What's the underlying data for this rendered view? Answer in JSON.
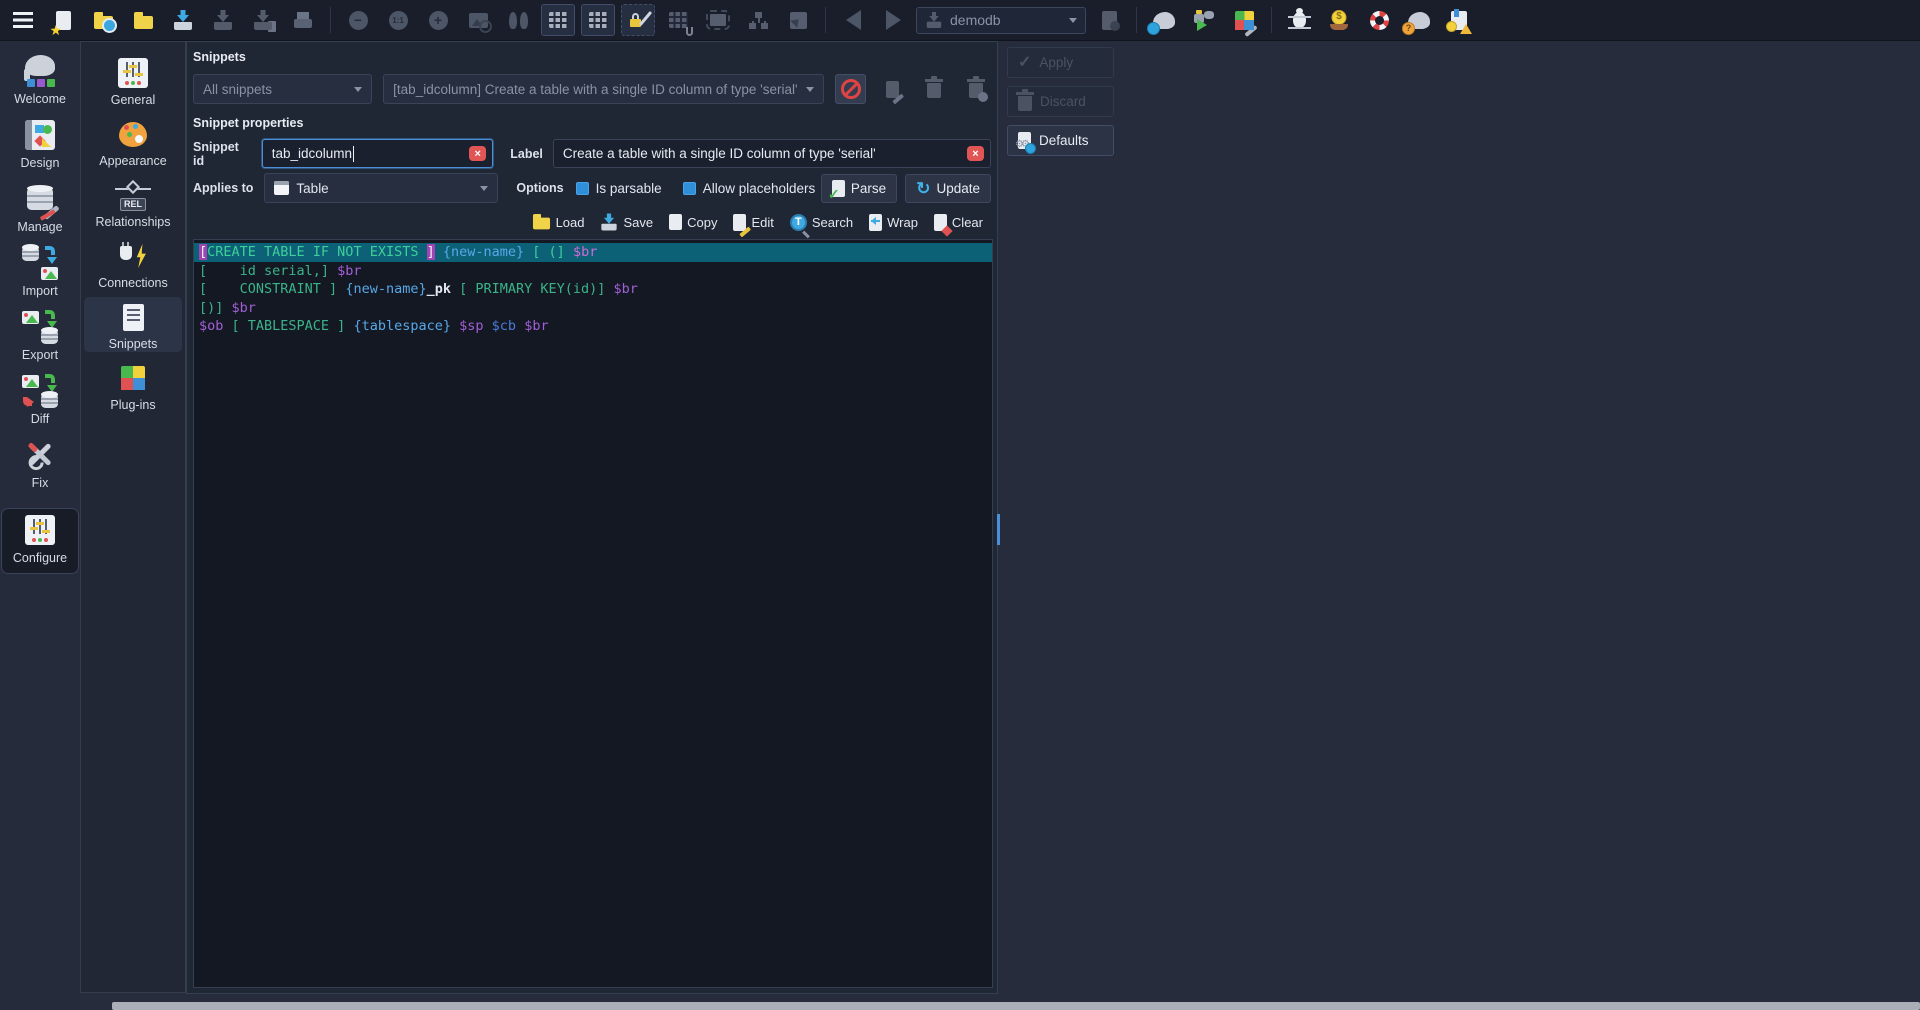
{
  "toolbar": {
    "model_selector_value": "demodb",
    "zoom_level_label": "1:1"
  },
  "activity_bar": {
    "items": [
      {
        "label": "Welcome"
      },
      {
        "label": "Design"
      },
      {
        "label": "Manage"
      },
      {
        "label": "Import"
      },
      {
        "label": "Export"
      },
      {
        "label": "Diff"
      },
      {
        "label": "Fix"
      },
      {
        "label": "Configure"
      }
    ]
  },
  "settings_nav": {
    "rel_badge": "REL",
    "items": [
      {
        "label": "General"
      },
      {
        "label": "Appearance"
      },
      {
        "label": "Relationships"
      },
      {
        "label": "Connections"
      },
      {
        "label": "Snippets"
      },
      {
        "label": "Plug-ins"
      }
    ]
  },
  "snippets_panel": {
    "title": "Snippets",
    "filter_dropdown_value": "All snippets",
    "snippet_dropdown_value": "[tab_idcolumn] Create a table with a single ID column of type 'serial'",
    "properties_title": "Snippet properties",
    "snippet_id_label": "Snippet id",
    "snippet_id_value": "tab_idcolumn",
    "label_label": "Label",
    "label_value": "Create a table with a single ID column of type 'serial'",
    "applies_to_label": "Applies to",
    "applies_to_value": "Table",
    "options_label": "Options",
    "is_parsable_label": "Is parsable",
    "allow_placeholders_label": "Allow placeholders",
    "parse_button_label": "Parse",
    "update_button_label": "Update",
    "editor_toolbar": {
      "load": "Load",
      "save": "Save",
      "copy": "Copy",
      "edit": "Edit",
      "search": "Search",
      "wrap": "Wrap",
      "clear": "Clear"
    },
    "editor_lines": [
      {
        "selected": true,
        "tokens": [
          {
            "t": "[",
            "c": "bm"
          },
          {
            "t": "CREATE TABLE IF NOT EXISTS ",
            "c": "k"
          },
          {
            "t": "]",
            "c": "bm"
          },
          {
            "t": " ",
            "c": "w"
          },
          {
            "t": "{new-name}",
            "c": "p"
          },
          {
            "t": " [ (] ",
            "c": "k"
          },
          {
            "t": "$br",
            "c": "v"
          }
        ]
      },
      {
        "selected": false,
        "tokens": [
          {
            "t": "[    id serial,] ",
            "c": "k"
          },
          {
            "t": "$br",
            "c": "v"
          }
        ]
      },
      {
        "selected": false,
        "tokens": [
          {
            "t": "[    CONSTRAINT ] ",
            "c": "k"
          },
          {
            "t": "{new-name}",
            "c": "p"
          },
          {
            "t": "_pk",
            "c": "w"
          },
          {
            "t": " [ PRIMARY KEY(id)] ",
            "c": "k"
          },
          {
            "t": "$br",
            "c": "v"
          }
        ]
      },
      {
        "selected": false,
        "tokens": [
          {
            "t": "[)] ",
            "c": "k"
          },
          {
            "t": "$br",
            "c": "v"
          }
        ]
      },
      {
        "selected": false,
        "tokens": [
          {
            "t": "$ob",
            "c": "v"
          },
          {
            "t": " [ TABLESPACE ] ",
            "c": "k"
          },
          {
            "t": "{tablespace}",
            "c": "p"
          },
          {
            "t": " ",
            "c": "w"
          },
          {
            "t": "$sp",
            "c": "v"
          },
          {
            "t": " ",
            "c": "w"
          },
          {
            "t": "$cb",
            "c": "c"
          },
          {
            "t": " ",
            "c": "w"
          },
          {
            "t": "$br",
            "c": "v"
          }
        ]
      }
    ]
  },
  "action_buttons": {
    "apply": "Apply",
    "discard": "Discard",
    "defaults": "Defaults"
  },
  "colors": {
    "accent": "#3f8fd6",
    "selection_line": "#0d6177",
    "code_green": "#3bb389",
    "code_blue": "#58a8e8",
    "code_purple": "#a25fd6",
    "bracket_match_bg": "#a243b5",
    "clear_icon_red": "#e25555",
    "checkbox_blue": "#2f8fd8"
  }
}
